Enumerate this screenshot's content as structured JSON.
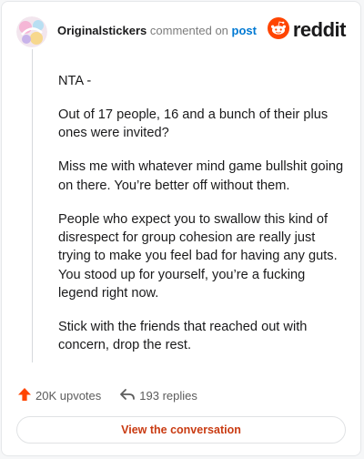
{
  "header": {
    "username": "Originalstickers",
    "action_text": "commented on",
    "post_link": "post",
    "logo_text": "reddit",
    "logo_icon": "reddit-snoo-icon",
    "brand_color": "#ff4500"
  },
  "comment": {
    "paragraphs": [
      "NTA -",
      "Out of 17 people, 16 and a bunch of their plus ones were invited?",
      "Miss me with whatever mind game bullshit going on there. You’re better off without them.",
      "People who expect you to swallow this kind of disrespect for group cohesion are really just trying to make you feel bad for having any guts. You stood up for yourself, you’re a fucking legend right now.",
      "Stick with the friends that reached out with concern, drop the rest."
    ]
  },
  "stats": {
    "upvotes": "20K upvotes",
    "upvote_icon": "upvote-arrow-icon",
    "replies": "193 replies",
    "reply_icon": "reply-arrow-icon"
  },
  "cta": {
    "label": "View the conversation"
  }
}
